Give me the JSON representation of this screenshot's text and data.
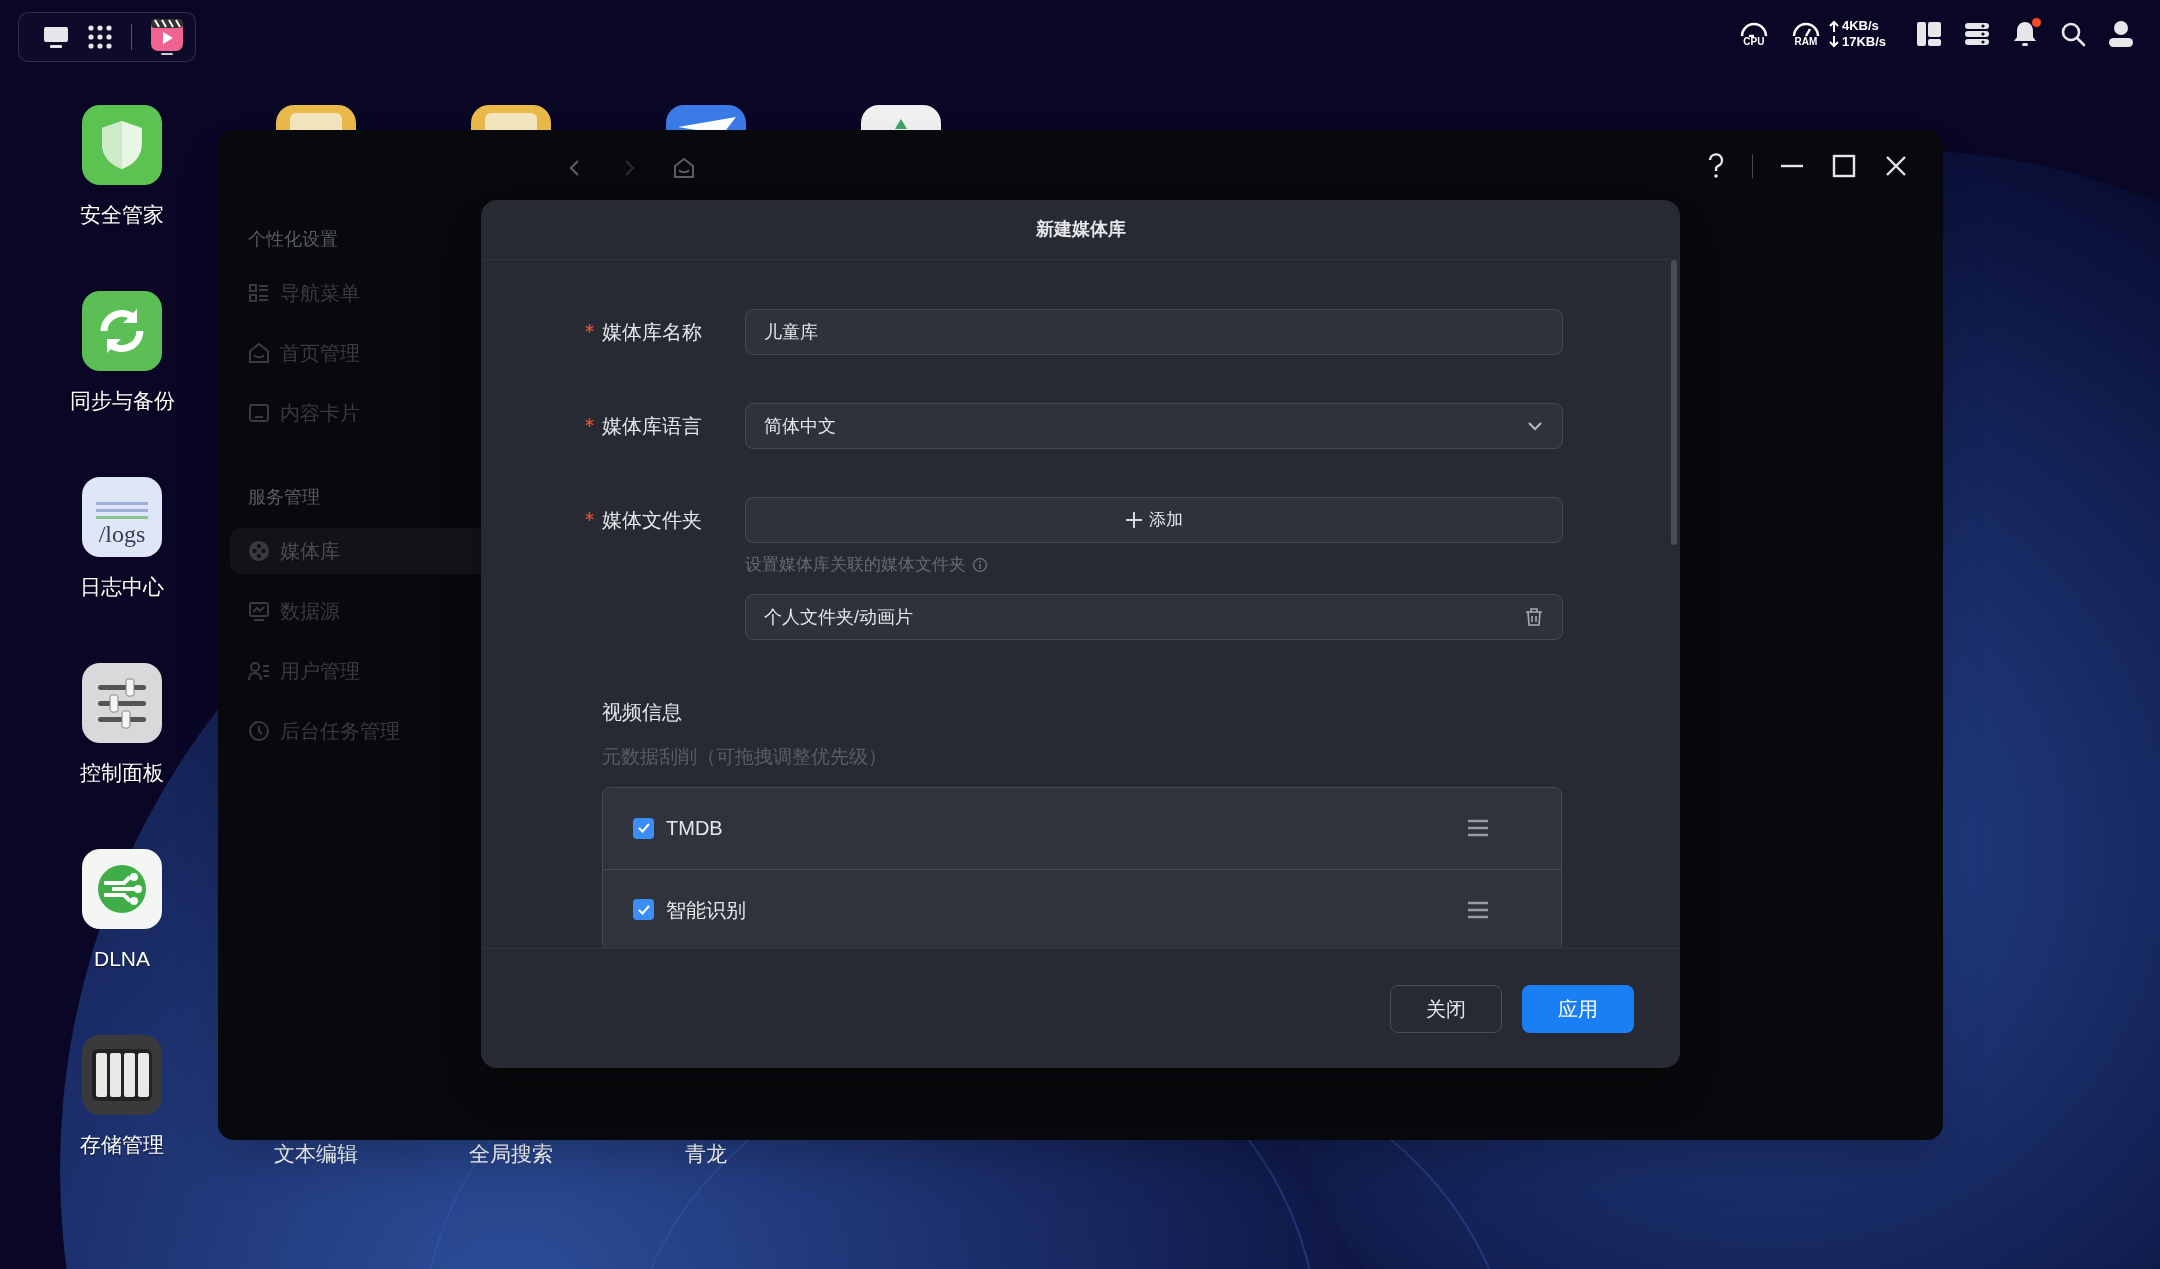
{
  "tray": {
    "cpu_label": "CPU",
    "ram_label": "RAM",
    "upload": "4KB/s",
    "download": "17KB/s",
    "has_unread": true
  },
  "desktop": {
    "left_column": [
      {
        "label": "安全管家"
      },
      {
        "label": "同步与备份"
      },
      {
        "label": "日志中心",
        "icon_text": "/logs"
      },
      {
        "label": "控制面板"
      },
      {
        "label": "DLNA"
      },
      {
        "label": "存储管理"
      }
    ],
    "bottom_row_labels": [
      "文本编辑",
      "全局搜索",
      "青龙"
    ]
  },
  "window": {
    "nav": {
      "back_disabled": false,
      "forward_disabled": true
    },
    "sidebar": {
      "sections": [
        {
          "title": "个性化设置",
          "items": [
            {
              "label": "导航菜单",
              "selected": false
            },
            {
              "label": "首页管理",
              "selected": false
            },
            {
              "label": "内容卡片",
              "selected": false
            }
          ]
        },
        {
          "title": "服务管理",
          "items": [
            {
              "label": "媒体库",
              "selected": true
            },
            {
              "label": "数据源",
              "selected": false
            },
            {
              "label": "用户管理",
              "selected": false
            },
            {
              "label": "后台任务管理",
              "selected": false
            }
          ]
        }
      ]
    }
  },
  "dialog": {
    "title": "新建媒体库",
    "fields": [
      {
        "kind": "text",
        "label": "媒体库名称",
        "required": true,
        "value": "儿童库"
      },
      {
        "kind": "select",
        "label": "媒体库语言",
        "required": true,
        "value": "简体中文"
      },
      {
        "kind": "folders",
        "label": "媒体文件夹",
        "required": true,
        "add_label": "添加",
        "help": "设置媒体库关联的媒体文件夹",
        "folders": [
          "个人文件夹/动画片"
        ]
      }
    ],
    "video_info": {
      "title": "视频信息",
      "subtitle": "元数据刮削（可拖拽调整优先级）",
      "scrapers": [
        {
          "label": "TMDB",
          "checked": true
        },
        {
          "label": "智能识别",
          "checked": true
        }
      ]
    },
    "buttons": [
      {
        "label": "关闭",
        "kind": "secondary"
      },
      {
        "label": "应用",
        "kind": "primary"
      }
    ]
  }
}
